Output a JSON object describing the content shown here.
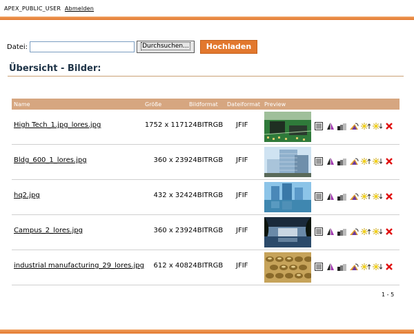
{
  "header": {
    "user": "APEX_PUBLIC_USER",
    "logout": "Abmelden"
  },
  "upload": {
    "label": "Datei:",
    "browse": "Durchsuchen...",
    "submit": "Hochladen"
  },
  "section": {
    "title": "Übersicht - Bilder:"
  },
  "table": {
    "columns": {
      "name": "Name",
      "size": "Größe",
      "format": "Bildformat",
      "filetype": "Dateiformat",
      "preview": "Preview"
    },
    "rows": [
      {
        "name": "High Tech_1.jpg_lores.jpg",
        "size": "1752 x 1171",
        "format": "24BITRGB",
        "filetype": "JFIF"
      },
      {
        "name": "Bldg_600_1_lores.jpg",
        "size": "360 x 239",
        "format": "24BITRGB",
        "filetype": "JFIF"
      },
      {
        "name": "hq2.jpg",
        "size": "432 x 324",
        "format": "24BITRGB",
        "filetype": "JFIF"
      },
      {
        "name": "Campus_2_lores.jpg",
        "size": "360 x 239",
        "format": "24BITRGB",
        "filetype": "JFIF"
      },
      {
        "name": "industrial manufacturing_29_lores.jpg",
        "size": "612 x 408",
        "format": "24BITRGB",
        "filetype": "JFIF"
      }
    ],
    "row_actions": [
      "properties-icon",
      "flip-icon",
      "grayscale-icon",
      "rotate-icon",
      "brightness-up-icon",
      "brightness-down-icon",
      "delete-icon"
    ]
  },
  "pagination": "1 - 5",
  "colors": {
    "accent": "#e2782e",
    "header_bg": "#d6a680",
    "title": "#1e3347"
  }
}
